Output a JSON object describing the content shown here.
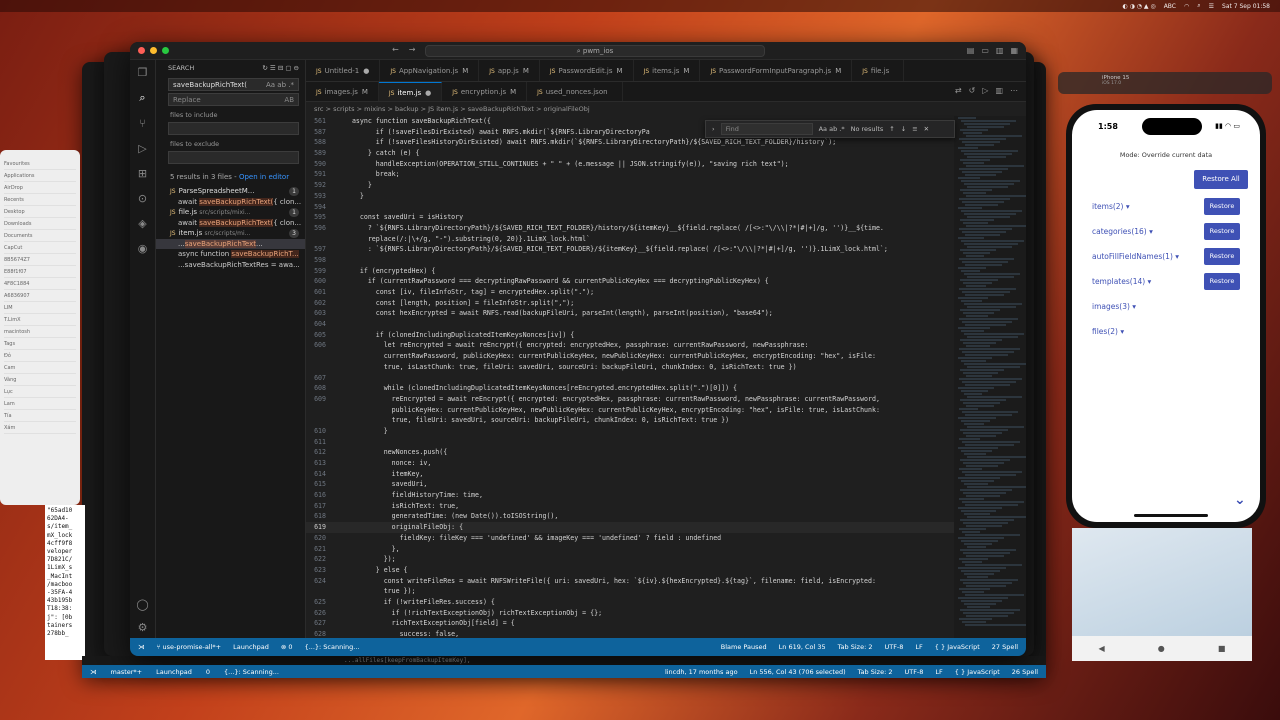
{
  "menubar": {
    "time": "Sat 7 Sep 01:58",
    "abc": "ABC"
  },
  "vscode": {
    "title": "pwm_ios",
    "search": {
      "header": "SEARCH",
      "query": "saveBackupRichText(",
      "replace_placeholder": "Replace",
      "replace_key": "AB",
      "include_label": "files to include",
      "exclude_label": "files to exclude",
      "result_summary": "5 results in 3 files - ",
      "open_editor": "Open in editor",
      "tree": [
        {
          "kind": "file",
          "name": "ParseSpreadsheetM...",
          "path": "",
          "count": "1"
        },
        {
          "kind": "match",
          "pre": "await ",
          "hl": "saveBackupRichText(",
          "post": "{ clon..."
        },
        {
          "kind": "file",
          "name": "file.js",
          "path": "src/scripts/mixi...",
          "count": "1"
        },
        {
          "kind": "match",
          "pre": "await ",
          "hl": "saveBackupRichText(",
          "post": "{ clon..."
        },
        {
          "kind": "file",
          "name": "item.js",
          "path": "src/scripts/mi...",
          "count": "3"
        },
        {
          "kind": "match",
          "pre": "...",
          "hl": "saveBackupRichText",
          "post": "...",
          "sel": true
        },
        {
          "kind": "match",
          "pre": "async function ",
          "hl": "saveBackupRichT...",
          "post": ""
        },
        {
          "kind": "match",
          "pre": "...saveBackupRichTextRes = awa...",
          "hl": "",
          "post": ""
        }
      ]
    },
    "tabs": [
      {
        "label": "Untitled-1",
        "mod": "●",
        "active": false
      },
      {
        "label": "AppNavigation.js",
        "mod": "M",
        "active": false
      },
      {
        "label": "app.js",
        "mod": "M",
        "active": false
      },
      {
        "label": "PasswordEdit.js",
        "mod": "M",
        "active": false
      },
      {
        "label": "items.js",
        "mod": "M",
        "active": false
      },
      {
        "label": "PasswordFormInputParagraph.js",
        "mod": "M",
        "active": false
      },
      {
        "label": "file.js",
        "mod": "",
        "active": false
      }
    ],
    "tabs2": [
      {
        "label": "images.js",
        "mod": "M",
        "active": false
      },
      {
        "label": "item.js",
        "mod": "●",
        "active": true
      },
      {
        "label": "encryption.js",
        "mod": "M",
        "active": false
      },
      {
        "label": "used_nonces.json",
        "mod": "",
        "active": false
      }
    ],
    "breadcrumb": "src > scripts > mixins > backup > JS item.js > saveBackupRichText > originalFileObj",
    "find": {
      "placeholder": "Find",
      "options": "Aa ab .*",
      "result": "No results"
    },
    "code": [
      {
        "n": "561",
        "t": "  async function saveBackupRichText({"
      },
      {
        "n": "587",
        "t": "        if (!saveFilesDirExisted) await RNFS.mkdir(`${RNFS.LibraryDirectoryPa"
      },
      {
        "n": "588",
        "t": "        if (!saveFilesHistoryDirExisted) await RNFS.mkdir(`${RNFS.LibraryDirectoryPath}/${SAVED_RICH_TEXT_FOLDER}/history`);"
      },
      {
        "n": "589",
        "t": "      } catch (e) {"
      },
      {
        "n": "590",
        "t": "        handleException(OPERATION_STILL_CONTINUES + \" \" + (e.message || JSON.stringify(e)), \"saving rich text\");"
      },
      {
        "n": "591",
        "t": "        break;"
      },
      {
        "n": "592",
        "t": "      }"
      },
      {
        "n": "593",
        "t": "    }"
      },
      {
        "n": "594",
        "t": ""
      },
      {
        "n": "595",
        "t": "    const savedUri = isHistory"
      },
      {
        "n": "596",
        "t": "      ? `${RNFS.LibraryDirectoryPath}/${SAVED_RICH_TEXT_FOLDER}/history/${itemKey}__${field.replace( /[<>:\"\\/\\\\|?*|#|+]/g, '')}__${time."
      },
      {
        "n": "",
        "t": "      replace(/:|\\+/g, \"-\").substring(0, 20)}.1LimX_lock.html`"
      },
      {
        "n": "597",
        "t": "      : `${RNFS.LibraryDirectoryPath}/${SAVED_RICH_TEXT_FOLDER}/${itemKey}__${field.replace( /[<>:\"\\/\\\\|?*|#|+]/g, '')}.1LimX_lock.html`;"
      },
      {
        "n": "598",
        "t": ""
      },
      {
        "n": "599",
        "t": "    if (encryptedHex) {"
      },
      {
        "n": "600",
        "t": "      if (currentRawPassword === decryptingRawPassword && currentPublicKeyHex === decryptingPublicKeyHex) {"
      },
      {
        "n": "601",
        "t": "        const [iv, fileInfoStr, tag] = encryptedHex.split(\".\");"
      },
      {
        "n": "602",
        "t": "        const [length, position] = fileInfoStr.split(\",\");"
      },
      {
        "n": "603",
        "t": "        const hexEncrypted = await RNFS.read(backupFileUri, parseInt(length), parseInt(position), \"base64\");"
      },
      {
        "n": "604",
        "t": ""
      },
      {
        "n": "605",
        "t": "        if (clonedIncludingDuplicatedItemKeysNonces[iv]) {"
      },
      {
        "n": "606",
        "t": "          let reEncrypted = await reEncrypt({ encrypted: encryptedHex, passphrase: currentRawPassword, newPassphrase:"
      },
      {
        "n": "",
        "t": "          currentRawPassword, publicKeyHex: currentPublicKeyHex, newPublicKeyHex: currentPublicKeyHex, encryptEncoding: \"hex\", isFile:"
      },
      {
        "n": "",
        "t": "          true, isLastChunk: true, fileUri: savedUri, sourceUri: backupFileUri, chunkIndex: 0, isRichText: true })"
      },
      {
        "n": "607",
        "t": ""
      },
      {
        "n": "608",
        "t": "          while (clonedIncludingDuplicatedItemKeysNonces[reEncrypted.encryptedHex.split(\".\")[0]]) {"
      },
      {
        "n": "609",
        "t": "            reEncrypted = await reEncrypt({ encrypted: encryptedHex, passphrase: currentRawPassword, newPassphrase: currentRawPassword,"
      },
      {
        "n": "",
        "t": "            publicKeyHex: currentPublicKeyHex, newPublicKeyHex: currentPublicKeyHex, encryptEncoding: \"hex\", isFile: true, isLastChunk:"
      },
      {
        "n": "",
        "t": "            true, fileUri: savedUri, sourceUri: backupFileUri, chunkIndex: 0, isRichText: true })"
      },
      {
        "n": "610",
        "t": "          }"
      },
      {
        "n": "611",
        "t": ""
      },
      {
        "n": "612",
        "t": "          newNonces.push({"
      },
      {
        "n": "613",
        "t": "            nonce: iv,"
      },
      {
        "n": "614",
        "t": "            itemKey,"
      },
      {
        "n": "615",
        "t": "            savedUri,"
      },
      {
        "n": "616",
        "t": "            fieldHistoryTime: time,"
      },
      {
        "n": "617",
        "t": "            isRichText: true,"
      },
      {
        "n": "618",
        "t": "            generatedTime: (new Date()).toISOString(),"
      },
      {
        "n": "619",
        "t": "            originalFileObj: {",
        "cur": true
      },
      {
        "n": "620",
        "t": "              fieldKey: fileKey === 'undefined' && imageKey === 'undefined' ? field : undefined"
      },
      {
        "n": "621",
        "t": "            },"
      },
      {
        "n": "622",
        "t": "          });"
      },
      {
        "n": "623",
        "t": "        } else {"
      },
      {
        "n": "624",
        "t": "          const writeFileRes = await RNFSWriteFile({ uri: savedUri, hex: `${iv}.${hexEncrypted}.${tag}`, filename: field, isEncrypted:"
      },
      {
        "n": "",
        "t": "          true });"
      },
      {
        "n": "625",
        "t": "          if (!writeFileRes.success) {"
      },
      {
        "n": "626",
        "t": "            if (!richTextExceptionObj) richTextExceptionObj = {};"
      },
      {
        "n": "627",
        "t": "            richTextExceptionObj[field] = {"
      },
      {
        "n": "628",
        "t": "              success: false,"
      }
    ],
    "status": {
      "branch": "use-promise-all*+",
      "launchpad": "Launchpad",
      "errors": "0",
      "scanning": "{...}: Scanning...",
      "blame": "Blame Paused",
      "pos": "Ln 619, Col 35",
      "tab": "Tab Size: 2",
      "enc": "UTF-8",
      "eol": "LF",
      "lang": "{ } JavaScript",
      "spell": "27 Spell"
    },
    "bottom_code": "...allFiles[keepFromBackupItemKey],",
    "status2": {
      "branch": "master*+",
      "launchpad": "Launchpad",
      "errors": "0",
      "scanning": "{...}: Scanning...",
      "blame": "lincdh, 17 months ago",
      "pos": "Ln 556, Col 43 (706 selected)",
      "tab": "Tab Size: 2",
      "enc": "UTF-8",
      "eol": "LF",
      "lang": "{ } JavaScript",
      "spell": "26 Spell"
    }
  },
  "finder": {
    "items": [
      "Favourites",
      "Applications",
      "AirDrop",
      "Recents",
      "Desktop",
      "Downloads",
      "Documents",
      "CapCut",
      "8B5674Z7",
      "E88f1f07",
      "4F8C1884",
      "A6836907",
      "LIM",
      "T.LimX",
      "macintosh",
      "Tags",
      "Đỏ",
      "Cam",
      "Vàng",
      "Lục",
      "Lam",
      "Tía",
      "Xám"
    ]
  },
  "terminal": {
    "lines": [
      "\"65ad10",
      "62DA4-",
      "s/item_",
      "mX_lock",
      "4cff9f8",
      "veloper",
      "7D821C/",
      "1LimX_s",
      "_MacInt",
      "/macboo",
      "-35FA-4",
      "43b195b",
      "T18:38:",
      "j\": [0b",
      "tainers",
      "278bb_"
    ]
  },
  "simulator": {
    "title": "iPhone 15",
    "subtitle": "iOS 17.0"
  },
  "phone": {
    "time": "1:58",
    "mode": "Mode: Override current data",
    "restore_all": "Restore All",
    "rows": [
      {
        "label": "items(2)",
        "btn": "Restore"
      },
      {
        "label": "categories(16)",
        "btn": "Restore"
      },
      {
        "label": "autoFillFieldNames(1)",
        "btn": "Restore"
      },
      {
        "label": "templates(14)",
        "btn": "Restore"
      },
      {
        "label": "images(3)",
        "btn": ""
      },
      {
        "label": "files(2)",
        "btn": ""
      }
    ]
  }
}
